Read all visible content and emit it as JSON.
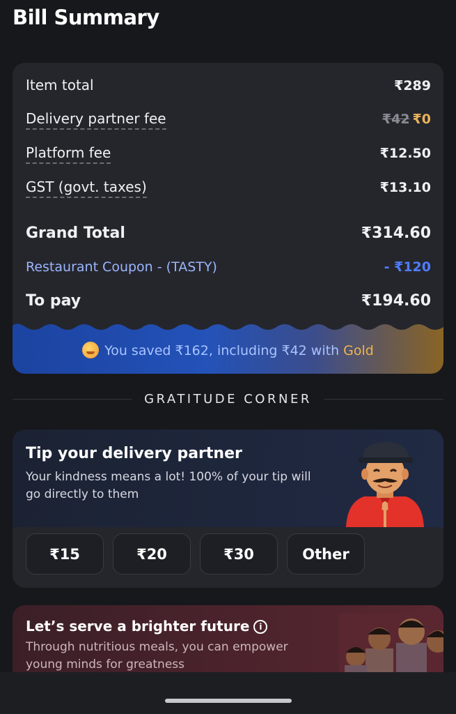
{
  "header": {
    "title": "Bill Summary"
  },
  "bill": {
    "rows": [
      {
        "label": "Item total",
        "value": "₹289"
      },
      {
        "label": "Delivery partner fee",
        "original": "₹42",
        "value": "₹0"
      },
      {
        "label": "Platform fee",
        "value": "₹12.50"
      },
      {
        "label": "GST (govt. taxes)",
        "value": "₹13.10"
      }
    ],
    "grand_total": {
      "label": "Grand Total",
      "value": "₹314.60"
    },
    "coupon": {
      "label": "Restaurant Coupon - (TASTY)",
      "value": "- ₹120"
    },
    "to_pay": {
      "label": "To pay",
      "value": "₹194.60"
    },
    "savings": {
      "text": "You saved ₹162, including ₹42 with",
      "gold_word": "Gold"
    }
  },
  "gratitude": {
    "heading": "GRATITUDE CORNER"
  },
  "tip": {
    "title": "Tip your delivery partner",
    "subtitle": "Your kindness means a lot! 100% of your tip will go directly to them",
    "options": [
      "₹15",
      "₹20",
      "₹30",
      "Other"
    ]
  },
  "future": {
    "title": "Let’s serve a brighter future",
    "subtitle": "Through nutritious meals, you can empower young minds for greatness"
  },
  "colors": {
    "background": "#17181c",
    "card": "#25262c",
    "coupon_blue": "#4f7cff",
    "gold": "#f0b54a"
  }
}
